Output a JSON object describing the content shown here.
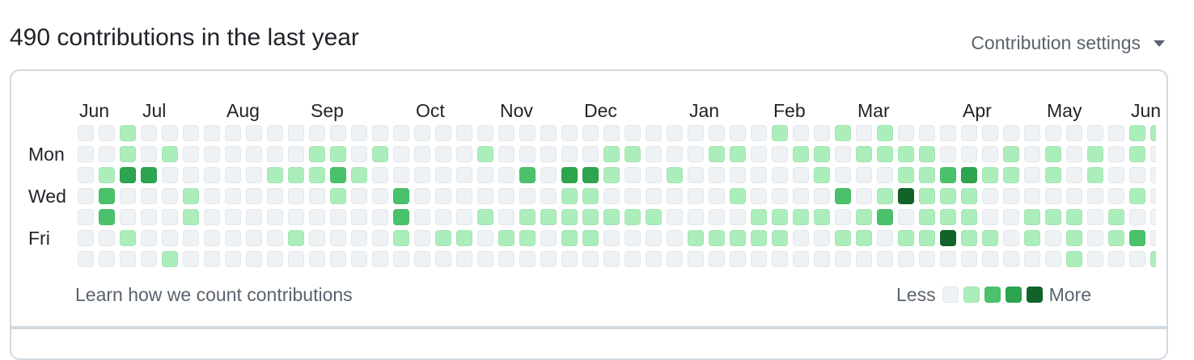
{
  "header": {
    "title": "490 contributions in the last year",
    "settings_label": "Contribution settings",
    "settings_icon": "triangle-down-icon"
  },
  "graph": {
    "months": [
      {
        "label": "Jun",
        "week": 0
      },
      {
        "label": "Jul",
        "week": 3
      },
      {
        "label": "Aug",
        "week": 7
      },
      {
        "label": "Sep",
        "week": 11
      },
      {
        "label": "Oct",
        "week": 16
      },
      {
        "label": "Nov",
        "week": 20
      },
      {
        "label": "Dec",
        "week": 24
      },
      {
        "label": "Jan",
        "week": 29
      },
      {
        "label": "Feb",
        "week": 33
      },
      {
        "label": "Mar",
        "week": 37
      },
      {
        "label": "Apr",
        "week": 42
      },
      {
        "label": "May",
        "week": 46
      },
      {
        "label": "Jun",
        "week": 50
      }
    ],
    "day_labels": [
      {
        "label": "Mon",
        "row": 1
      },
      {
        "label": "Wed",
        "row": 3
      },
      {
        "label": "Fri",
        "row": 5
      }
    ],
    "levels_by_row": [
      "0010000000000000000000000000000001001010000000000011011",
      "0010100000011010000100000110001100110111100010101010000",
      "0133000001112100000002033100100000010001123110101000000",
      "0200010000001002000000011000000100002014111000000010000",
      "0200010000000002000101111111000011110120111001110100000",
      "0010000000100001011011011000011111001101141101010120000",
      "0000100000000000000000000000000000000000000000010001000"
    ],
    "level_colors": [
      "#eff2f5",
      "#aceebb",
      "#4ac26b",
      "#2da44e",
      "#116329"
    ]
  },
  "footer": {
    "learn_link": "Learn how we count contributions",
    "legend_less": "Less",
    "legend_more": "More"
  }
}
